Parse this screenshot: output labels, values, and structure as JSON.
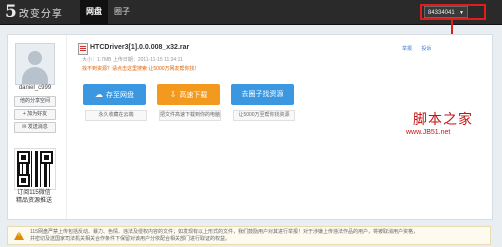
{
  "header": {
    "logo_mark": "5",
    "logo_text": "改变分享",
    "nav": [
      {
        "label": "网盘",
        "active": true
      },
      {
        "label": "圈子",
        "active": false
      }
    ],
    "user_id": "84334041",
    "user_caret": "▼",
    "highlight_color": "#e01c1c"
  },
  "sidebar": {
    "username": "daniel_c999",
    "buttons": [
      "他的分享空间",
      "+ 加为好友",
      "✉ 发送消息"
    ],
    "qr_caption_1": "订阅115微信",
    "qr_caption_2": "精品资源推送"
  },
  "file": {
    "name": "HTCDriver3[1].0.0.008_x32.rar",
    "meta": "大小：1.7MB    上传日期：2011-11-15 11:34:11",
    "warning": "找不到资源？请点击这里搜索 让5000万网友帮你找！",
    "report": "举报",
    "complain": "投诉"
  },
  "actions": [
    {
      "label": "存至网盘",
      "icon": "cloud-icon",
      "sub": "永久收藏在云端"
    },
    {
      "label": "高速下载",
      "icon": "download-icon",
      "sub": "把文件高速下载到你的电脑"
    },
    {
      "label": "去圈子找资源",
      "icon": "",
      "sub": "让5000万至帮你找资源"
    }
  ],
  "watermark": {
    "title": "脚本之家",
    "url": "www.JB51.net"
  },
  "notice": {
    "line1": "115网盘严禁上传包括反动、暴力、色情、违法及侵权内容的文件；如发现有以上形式的文件，我们鼓励用户对其进行举报！对于涉嫌上传违法作品的用户，将被取消用户资格，",
    "line2": "并密切及送国家司法机关相关合作条件下保留对该用户分依配合相关部门进行取证的权益。"
  }
}
